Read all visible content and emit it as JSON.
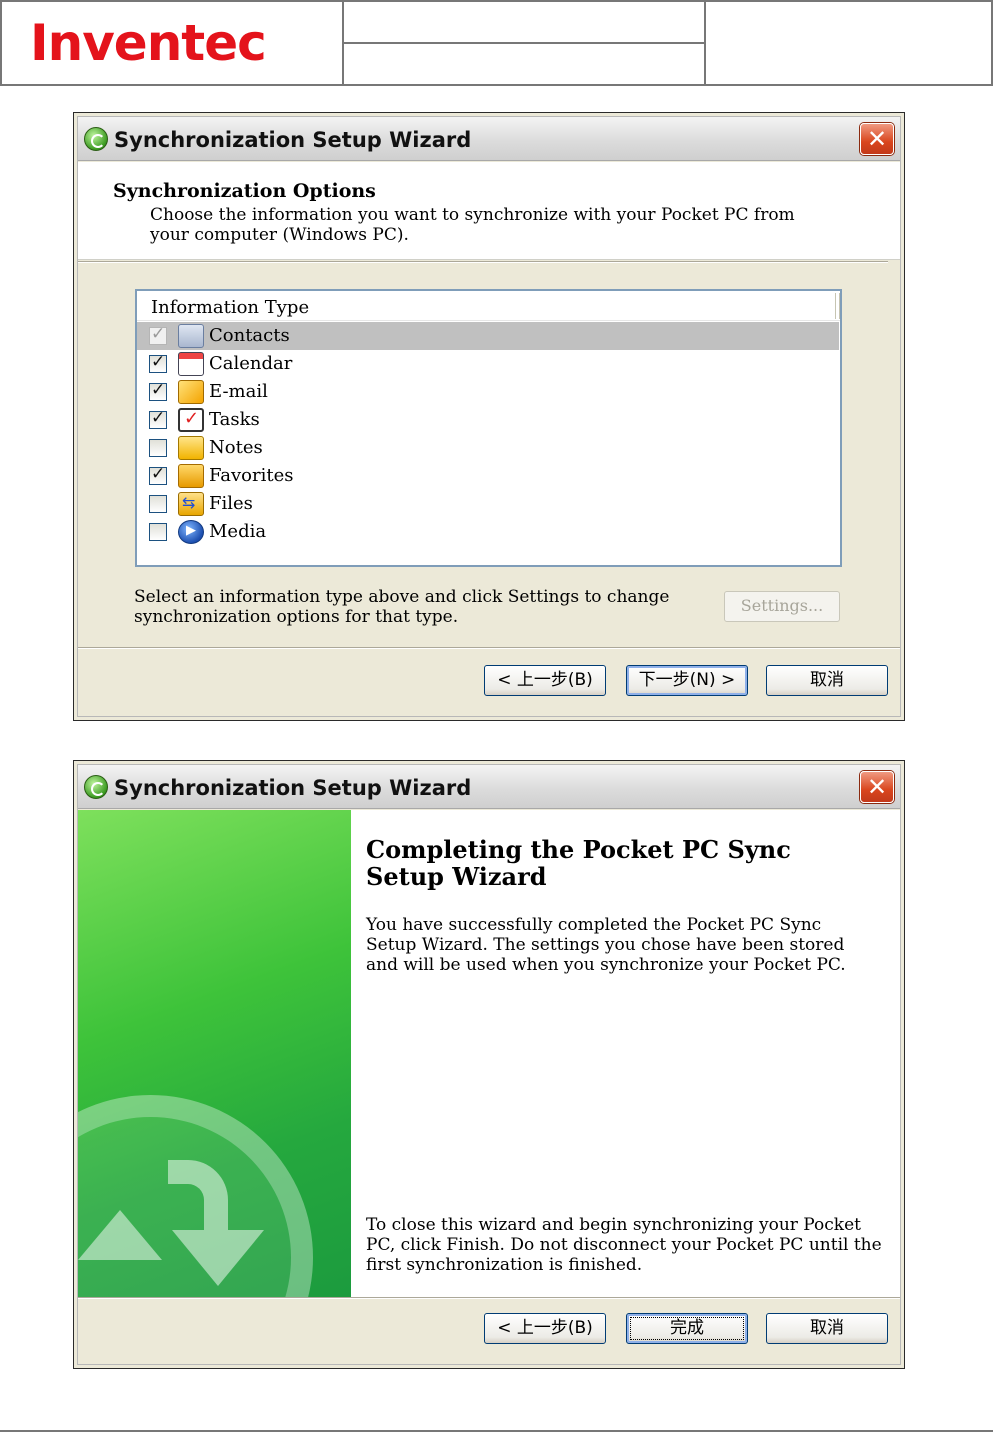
{
  "doc_header": {
    "logo": "Inventec"
  },
  "window1": {
    "title": "Synchronization Setup Wizard",
    "close_label": "✕",
    "header_title": "Synchronization Options",
    "header_desc": "Choose the information you want to synchronize with your Pocket PC from your computer (Windows PC).",
    "list_header": "Information Type",
    "items": [
      {
        "label": "Contacts",
        "checked": true,
        "icon": "contacts-icon",
        "selected": true,
        "disabled": true
      },
      {
        "label": "Calendar",
        "checked": true,
        "icon": "calendar-icon"
      },
      {
        "label": "E-mail",
        "checked": true,
        "icon": "email-icon"
      },
      {
        "label": "Tasks",
        "checked": true,
        "icon": "tasks-icon"
      },
      {
        "label": "Notes",
        "checked": false,
        "icon": "notes-icon"
      },
      {
        "label": "Favorites",
        "checked": true,
        "icon": "favorites-icon"
      },
      {
        "label": "Files",
        "checked": false,
        "icon": "files-icon"
      },
      {
        "label": "Media",
        "checked": false,
        "icon": "media-icon"
      }
    ],
    "hint": "Select an information type above and click Settings to change synchronization options for that type.",
    "settings_label": "Settings...",
    "back_label": "< 上一步(B)",
    "next_label": "下一步(N) >",
    "cancel_label": "取消"
  },
  "window2": {
    "title": "Synchronization Setup Wizard",
    "close_label": "✕",
    "heading": "Completing the Pocket PC Sync Setup Wizard",
    "para1": "You have successfully completed the Pocket PC Sync Setup Wizard.  The settings you chose have been stored and will be used when you synchronize your Pocket PC.",
    "para2": "To close this wizard and begin synchronizing your Pocket PC, click Finish.  Do not disconnect your Pocket PC until the first synchronization is finished.",
    "back_label": "< 上一步(B)",
    "finish_label": "完成",
    "cancel_label": "取消"
  }
}
